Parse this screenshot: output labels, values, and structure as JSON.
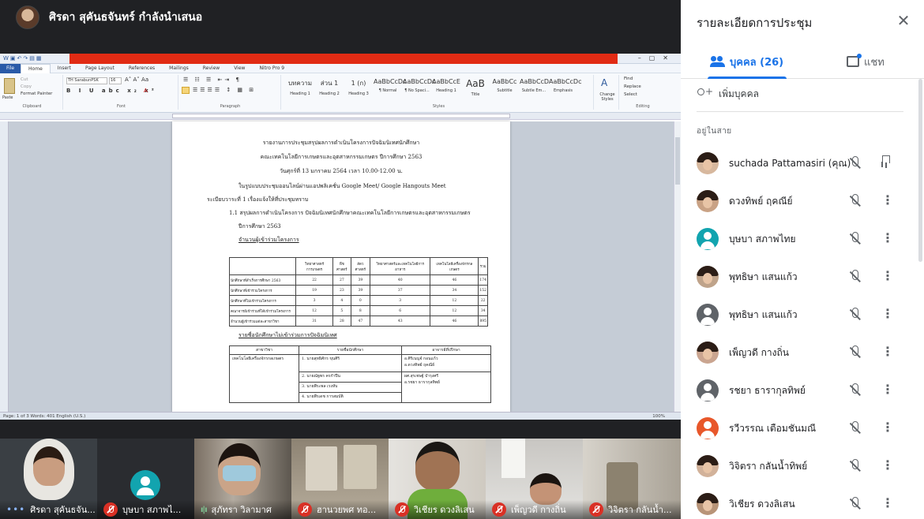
{
  "presenter": {
    "name": "ศิรดา สุคันธจันทร์ กำลังนำเสนอ"
  },
  "word": {
    "title": "",
    "menu": [
      "File",
      "Home",
      "Insert",
      "Page Layout",
      "References",
      "Mailings",
      "Review",
      "View",
      "Nitro Pro 9"
    ],
    "font_name": "TH SarabunPSK",
    "font_size": "16",
    "clipboard": {
      "cut": "Cut",
      "copy": "Copy",
      "painter": "Format Painter",
      "paste": "Paste",
      "label": "Clipboard"
    },
    "group_labels": {
      "font": "Font",
      "paragraph": "Paragraph",
      "styles": "Styles",
      "editing": "Editing"
    },
    "styles": [
      {
        "sample": "บทความ",
        "name": "Heading 1"
      },
      {
        "sample": "ส่วน 1",
        "name": "Heading 2"
      },
      {
        "sample": "1 (ก)",
        "name": "Heading 3"
      },
      {
        "sample": "AaBbCcDc",
        "name": "¶ Normal"
      },
      {
        "sample": "AaBbCcDc",
        "name": "¶ No Spaci..."
      },
      {
        "sample": "AaBbCcE",
        "name": "Heading 1"
      },
      {
        "sample": "AaB",
        "name": "Title"
      },
      {
        "sample": "AaBbCc",
        "name": "Subtitle"
      },
      {
        "sample": "AaBbCcD",
        "name": "Subtle Em..."
      },
      {
        "sample": "AaBbCcDc",
        "name": "Emphasis"
      }
    ],
    "change_styles": "Change Styles",
    "editing": [
      "Find",
      "Replace",
      "Select"
    ],
    "status_left": "Page: 1 of 3   Words: 401   English (U.S.)",
    "status_right": "100%"
  },
  "doc": {
    "line1": "รายงานการประชุมสรุปผลการดำเนินโครงการปัจฉิมนิเทศนักศึกษา",
    "line2": "คณะเทคโนโลยีการเกษตรและอุตสาหกรรมเกษตร  ปีการศึกษา 2563",
    "line3": "วันศุกร์ที่  13 มกราคม   2564 เวลา 10.00-12.00 น.",
    "line4": "ในรูปแบบประชุมออนไลน์ผ่านแอปพลิเคชั่น  Google Meet/ Google Hangouts Meet",
    "line5": "ระเบียบวาระที่  1  เรื่องแจ้งให้ที่ประชุมทราบ",
    "line6": "1.1 สรุปผลการดำเนินโครงการ ปัจฉิมนิเทศนักศึกษาคณะเทคโนโลยีการเกษตรและอุตสาหกรรมเกษตร",
    "line7": "ปีการศึกษา 2563",
    "line8": "จำนวนผู้เข้าร่วมโครงการ",
    "line9": "รายชื่อนักศึกษาไม่เข้าร่วมการปัจฉิมนิเทศ",
    "table1": {
      "headers": [
        "",
        "วิทยาศาสตร์การเกษตร",
        "พืชศาสตร์",
        "สัตวศาสตร์",
        "วิทยาศาสตร์และเทคโนโลยีการอาหาร",
        "เทคโนโลยีเครื่องจักรกลเกษตร",
        "รวม"
      ],
      "rows": [
        [
          "นักศึกษาที่สำเร็จการศึกษา 2563",
          "22",
          "27",
          "39",
          "40",
          "46",
          "174"
        ],
        [
          "นักศึกษาที่เข้าร่วมโครงการ",
          "19",
          "23",
          "39",
          "37",
          "34",
          "152"
        ],
        [
          "นักศึกษาที่ไม่เข้าร่วมโครงการ",
          "3",
          "4",
          "0",
          "3",
          "12",
          "22"
        ],
        [
          "คณาจารย์เข้าร่วมที่ได้เข้าร่วมโครงการ",
          "12",
          "5",
          "8",
          "6",
          "12",
          "34"
        ],
        [
          "จำนวนผู้เข้าร่วมแต่ละสาขาวิชา",
          "31",
          "28",
          "47",
          "43",
          "46",
          "895"
        ]
      ]
    },
    "table2": {
      "headers": [
        "สาขาวิชา",
        "รายชื่อนักศึกษา",
        "อาจารย์ที่ปรึกษา"
      ],
      "program": "เทคโนโลยีเครื่องจักรกลเกษตร",
      "students": [
        "1. นายสุทธิศักร  ขุนศิริ",
        "2. นายณัฐพร  ครกำปืน",
        "3. นายพีระพล  เรงหับ",
        "4. นายพีรเดช  การสมบัติ"
      ],
      "advisors_1": [
        "อ.ศิริเบญจ์  กอนแก้ว",
        "อ.ดวงทิพย์  ฤคณีย์"
      ],
      "advisors_2": [
        "ผศ.สุรเชษฐ์  บำรุงศรี",
        "อ.รชยา ธารากุลทิพย์"
      ]
    }
  },
  "strip": [
    {
      "name": "ศิรดา สุคันธจัน...",
      "status": "speaking-dots"
    },
    {
      "name": "บุษบา สภาพไ...",
      "status": "muted"
    },
    {
      "name": "สุภัทรา วิลามาศ",
      "status": "talking"
    },
    {
      "name": "ฮานวยพศ ทอ...",
      "status": "muted"
    },
    {
      "name": "วิเชียร ดวงลิเสน",
      "status": "muted"
    },
    {
      "name": "เพ็ญวดี กางถิ่น",
      "status": "muted"
    },
    {
      "name": "วิจิตรา กลันน้ำ...",
      "status": "muted"
    }
  ],
  "sidebar": {
    "title": "รายละเอียดการประชุม",
    "tab_people": "บุคคล (26)",
    "tab_chat": "แชท",
    "add_person": "เพิ่มบุคคล",
    "section": "อยู่ในสาย",
    "participants": [
      {
        "name": "suchada Pattamasiri (คุณ)",
        "avatar": "face",
        "color": "#d7b89e",
        "action": "pin"
      },
      {
        "name": "ดวงทิพย์ ฤคณีย์",
        "avatar": "face",
        "color": "#c9a285",
        "action": "more"
      },
      {
        "name": "บุษบา สภาพไทย",
        "avatar": "generic",
        "color": "#12a4af",
        "action": "more"
      },
      {
        "name": "พุทธิษา แสนแก้ว",
        "avatar": "face",
        "color": "#bfa38a",
        "action": "more"
      },
      {
        "name": "พุทธิษา แสนแก้ว",
        "avatar": "generic",
        "color": "#5f6368",
        "action": "more"
      },
      {
        "name": "เพ็ญวดี กางถิ่น",
        "avatar": "face",
        "color": "#caa590",
        "action": "more"
      },
      {
        "name": "รชยา ธารากุลทิพย์",
        "avatar": "generic",
        "color": "#5f6368",
        "action": "more"
      },
      {
        "name": "รวีวรรณ เตือมชันมณี",
        "avatar": "generic",
        "color": "#e8572a",
        "action": "more"
      },
      {
        "name": "วิจิตรา กลันน้ำทิพย์",
        "avatar": "face",
        "color": "#d2b29a",
        "action": "more"
      },
      {
        "name": "วิเชียร ดวงลิเสน",
        "avatar": "face",
        "color": "#b89478",
        "action": "more"
      }
    ]
  }
}
